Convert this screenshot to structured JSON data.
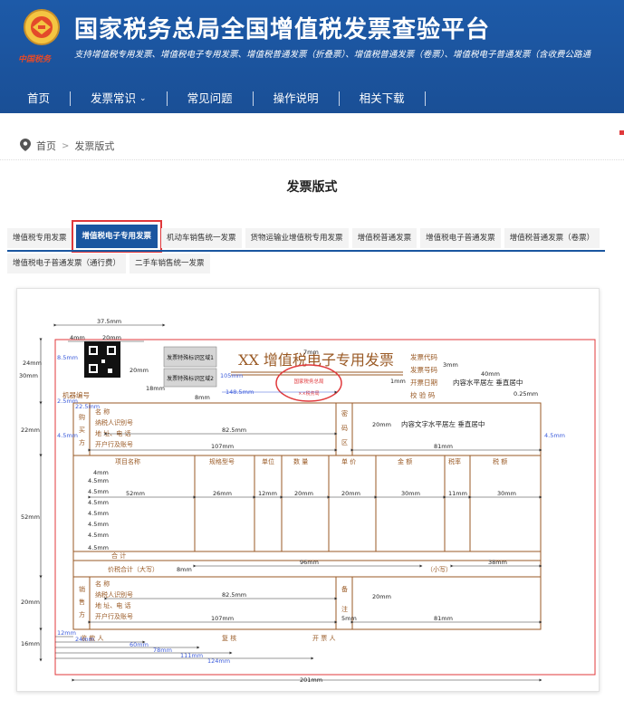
{
  "header": {
    "title": "国家税务总局全国增值税发票查验平台",
    "subtitle": "支持增值税专用发票、增值税电子专用发票、增值税普通发票（折叠票）、增值税普通发票（卷票）、增值税电子普通发票（含收费公路通",
    "emblem_caption": "中国税务",
    "bg_color": "#1d5aa8"
  },
  "nav": {
    "items": [
      {
        "label": "首页"
      },
      {
        "label": "发票常识",
        "has_dropdown": true
      },
      {
        "label": "常见问题"
      },
      {
        "label": "操作说明"
      },
      {
        "label": "相关下载"
      }
    ]
  },
  "breadcrumb": {
    "home": "首页",
    "separator": ">",
    "current": "发票版式"
  },
  "page_title": "发票版式",
  "tabs": {
    "row1": [
      "增值税专用发票",
      "增值税电子专用发票",
      "机动车销售统一发票",
      "货物运输业增值税专用发票",
      "增值税普通发票",
      "增值税电子普通发票",
      "增值税普通发票（卷票）"
    ],
    "row2": [
      "增值税电子普通发票（通行费）",
      "二手车销售统一发票"
    ],
    "active": "增值税电子专用发票",
    "active_color": "#1a56a0",
    "highlight_color": "#e0383b"
  },
  "invoice": {
    "title": "XX 增值税电子专用发票",
    "labels": {
      "code": "发票代码",
      "number": "发票号码",
      "date": "开票日期",
      "check": "校 验 码",
      "machine": "机器编号",
      "buyer_side": [
        "购",
        "买",
        "方"
      ],
      "seller_side": [
        "销",
        "售",
        "方"
      ],
      "name": "名      称",
      "tax_id": "纳税人识别号",
      "addr": "地 址、电 话",
      "bank": "开户行及账号",
      "cipher_side": [
        "密",
        "码",
        "区"
      ],
      "remark_side": [
        "备",
        "注"
      ],
      "columns": [
        "项目名称",
        "规格型号",
        "单位",
        "数 量",
        "单 价",
        "金 额",
        "税率",
        "税 额"
      ],
      "total": "合      计",
      "price_tax_total": "价税合计（大写）",
      "small_caps": "（小写）",
      "payee": "收 款 人",
      "reviewer": "复 核",
      "issuer": "开 票 人",
      "qr_label1": "发票特殊标识区域1",
      "qr_label2": "发票特殊标识区域2",
      "stamp_text": "国家税务总局",
      "stamp_sub": "××税务局",
      "align_note1": "内容水平居左 垂直居中",
      "align_note2": "内容文字水平居左 垂直居中"
    },
    "dims": {
      "d37_5": "37.5mm",
      "d4": "4mm",
      "d20": "20mm",
      "d24": "24mm",
      "d8_5": "8.5mm",
      "d30": "30mm",
      "d18": "18mm",
      "d20b": "20mm",
      "d105": "105mm",
      "d148_5": "148.5mm",
      "d8": "8mm",
      "d7": "7mm",
      "d3": "3mm",
      "d40": "40mm",
      "d0_25": "0.25mm",
      "d1": "1mm",
      "d2_5": "2.5mm",
      "d22_5": "22.5mm",
      "d22": "22mm",
      "d4_5": "4.5mm",
      "d82_5": "82.5mm",
      "d107": "107mm",
      "d81": "81mm",
      "d5": "5mm",
      "d52": "52mm",
      "d26": "26mm",
      "d12": "12mm",
      "d30b": "30mm",
      "d11": "11mm",
      "d96": "96mm",
      "d38": "38mm",
      "d16": "16mm",
      "d12b": "12mm",
      "d60": "60mm",
      "d78": "78mm",
      "d111": "111mm",
      "d124": "124mm",
      "d201": "201mm"
    }
  }
}
